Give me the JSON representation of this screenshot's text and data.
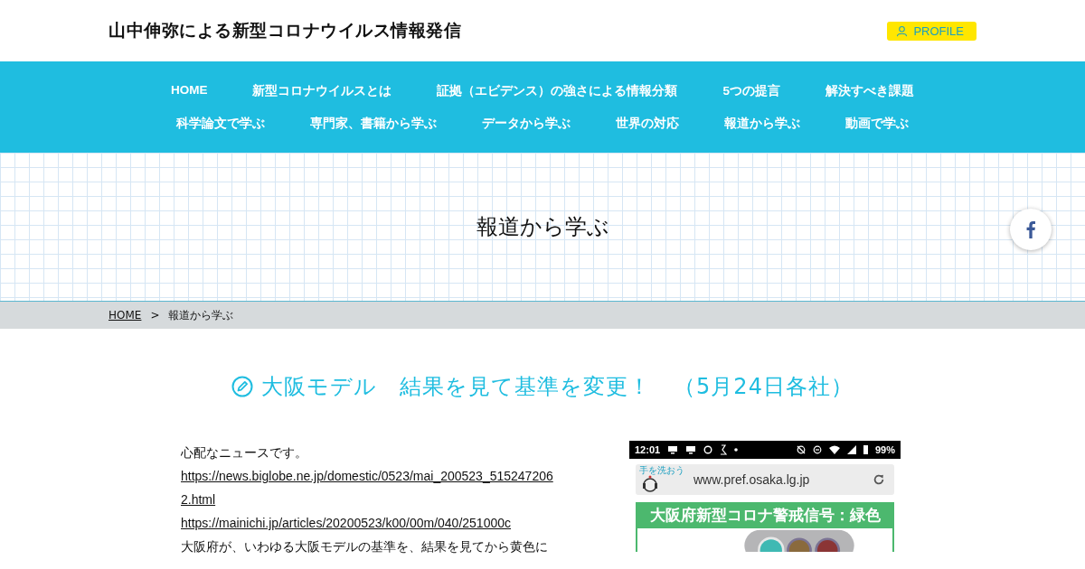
{
  "site_title": "山中伸弥による新型コロナウイルス情報発信",
  "profile_button": "PROFILE",
  "nav_rows": [
    [
      "HOME",
      "新型コロナウイルスとは",
      "証拠（エビデンス）の強さによる情報分類",
      "5つの提言",
      "解決すべき課題"
    ],
    [
      "科学論文で学ぶ",
      "専門家、書籍から学ぶ",
      "データから学ぶ",
      "世界の対応",
      "報道から学ぶ",
      "動画で学ぶ"
    ]
  ],
  "page_heading": "報道から学ぶ",
  "breadcrumb": {
    "home": "HOME",
    "separator": ">",
    "current": "報道から学ぶ"
  },
  "post_title": "大阪モデル　結果を見て基準を変更！　（5月24日各社）",
  "paragraphs": [
    {
      "kind": "text",
      "text": "心配なニュースです。"
    },
    {
      "kind": "link",
      "text": "https://news.biglobe.ne.jp/domestic/0523/mai_200523_5152472062.html"
    },
    {
      "kind": "link",
      "text": "https://mainichi.jp/articles/20200523/k00/00m/040/251000c"
    },
    {
      "kind": "text",
      "text": "大阪府が、いわゆる大阪モデルの基準を、結果を見てから黄色に"
    }
  ],
  "phone": {
    "time": "12:01",
    "battery": "99%",
    "badge": "手を洗おう",
    "url": "www.pref.osaka.lg.jp",
    "banner": "大阪府新型コロナ警戒信号：緑色"
  }
}
